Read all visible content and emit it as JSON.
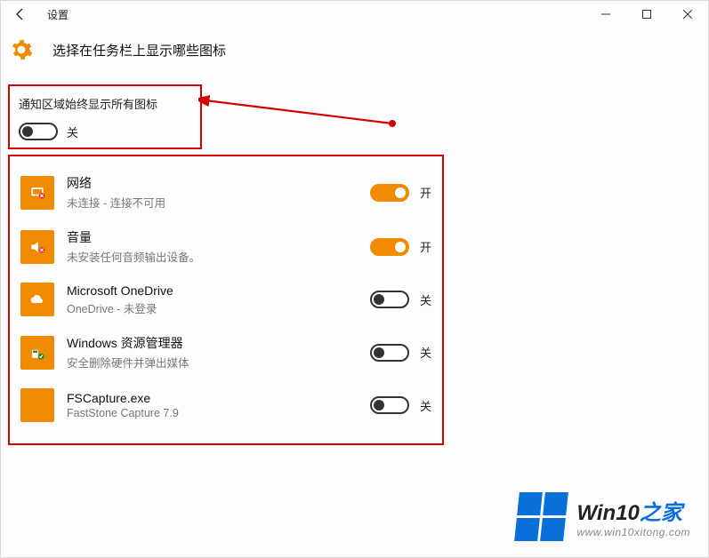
{
  "window": {
    "title": "设置"
  },
  "page": {
    "heading": "选择在任务栏上显示哪些图标"
  },
  "master": {
    "label": "通知区域始终显示所有图标",
    "state_text": "关",
    "on": false
  },
  "items": [
    {
      "title": "网络",
      "subtitle": "未连接 - 连接不可用",
      "on": true,
      "state_text": "开",
      "icon": "network-icon"
    },
    {
      "title": "音量",
      "subtitle": "未安装任何音频输出设备。",
      "on": true,
      "state_text": "开",
      "icon": "volume-icon"
    },
    {
      "title": "Microsoft OneDrive",
      "subtitle": "OneDrive - 未登录",
      "on": false,
      "state_text": "关",
      "icon": "onedrive-icon"
    },
    {
      "title": "Windows 资源管理器",
      "subtitle": "安全删除硬件并弹出媒体",
      "on": false,
      "state_text": "关",
      "icon": "explorer-icon"
    },
    {
      "title": "FSCapture.exe",
      "subtitle": "FastStone Capture 7.9",
      "on": false,
      "state_text": "关",
      "icon": "fscapture-icon"
    }
  ],
  "watermark": {
    "line1a": "Win10",
    "line1b": "之家",
    "line2": "www.win10xitong.com"
  }
}
